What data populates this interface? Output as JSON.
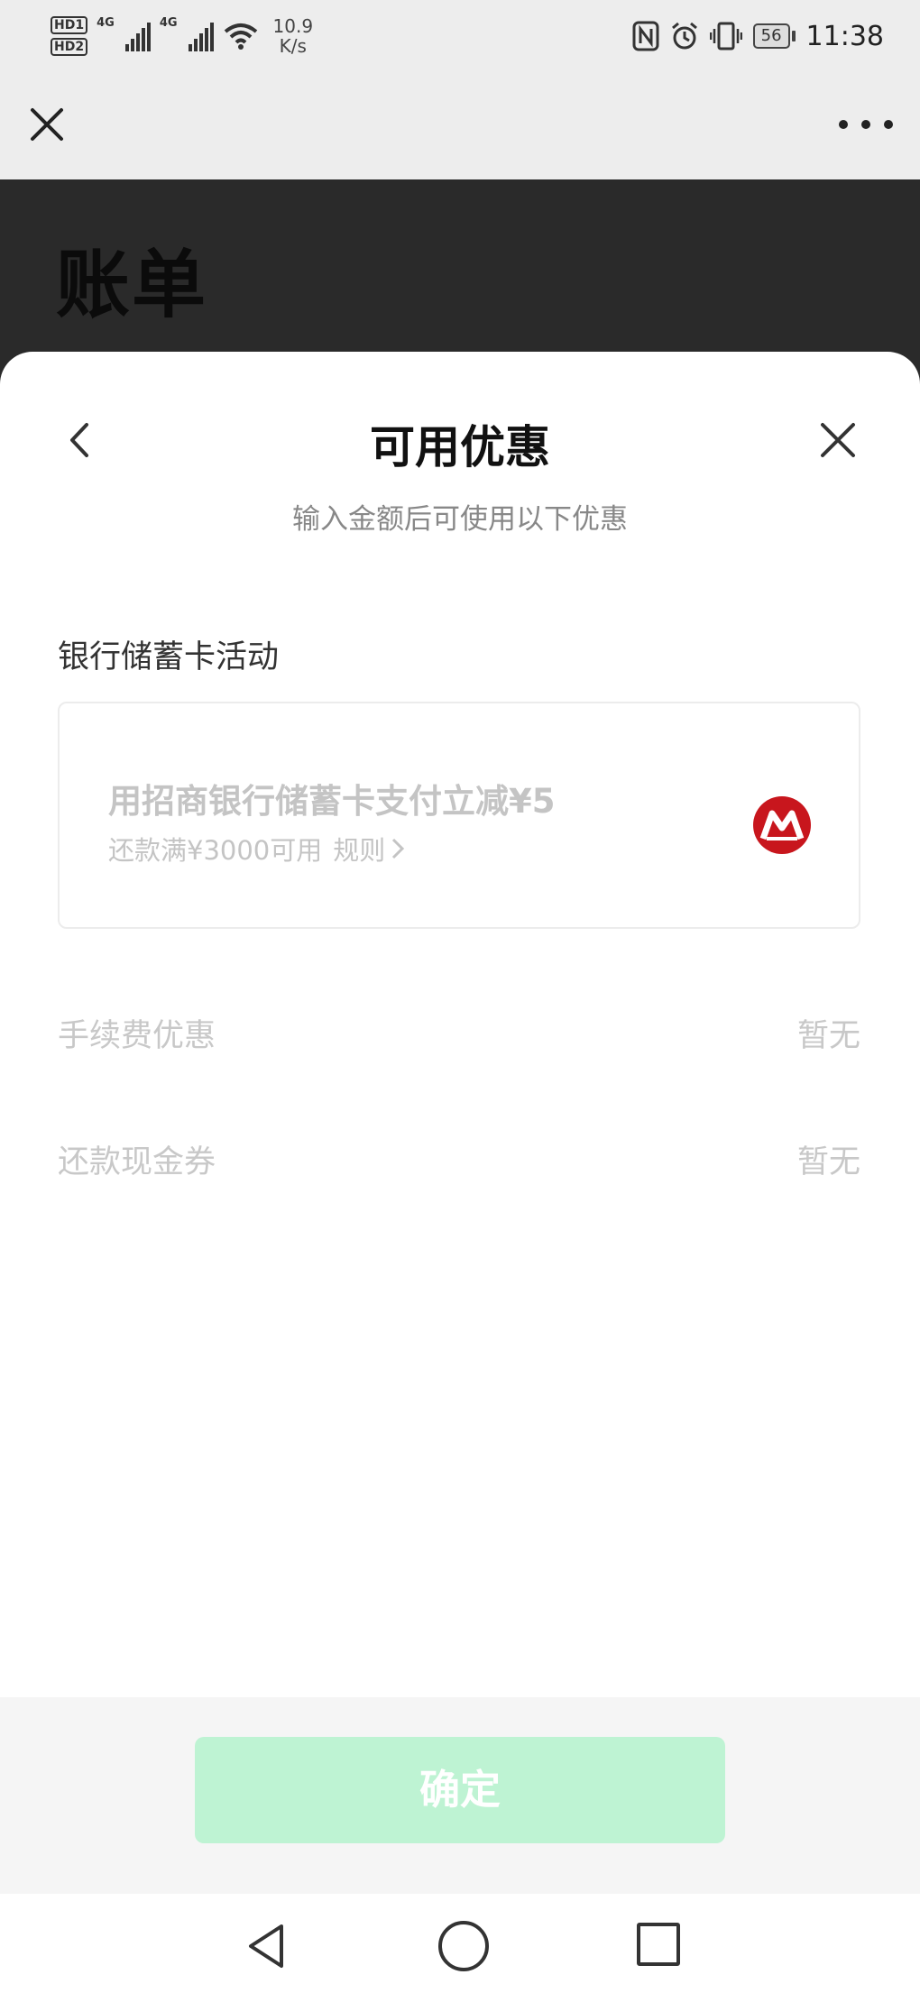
{
  "status_bar": {
    "hd1": "HD1",
    "hd2": "HD2",
    "net1": "4G",
    "net2": "4G",
    "speed_value": "10.9",
    "speed_unit": "K/s",
    "battery": "56",
    "time": "11:38"
  },
  "nav": {
    "close_icon": "close-icon",
    "more_icon": "more-icon"
  },
  "page": {
    "title": "账单"
  },
  "sheet": {
    "title": "可用优惠",
    "subtitle": "输入金额后可使用以下优惠",
    "section_title": "银行储蓄卡活动",
    "coupon": {
      "title": "用招商银行储蓄卡支付立减¥5",
      "condition": "还款满¥3000可用",
      "rules_link": "规则",
      "logo_icon": "cmb-logo-icon",
      "logo_color": "#c8161d"
    },
    "rows": [
      {
        "label": "手续费优惠",
        "value": "暂无"
      },
      {
        "label": "还款现金券",
        "value": "暂无"
      }
    ]
  },
  "bottom": {
    "confirm_label": "确定",
    "confirm_color": "#bef3d3"
  },
  "colors": {
    "dark_page": "#2a2a2a",
    "muted_text": "#c4c4c4",
    "accent_green": "#07c160"
  }
}
